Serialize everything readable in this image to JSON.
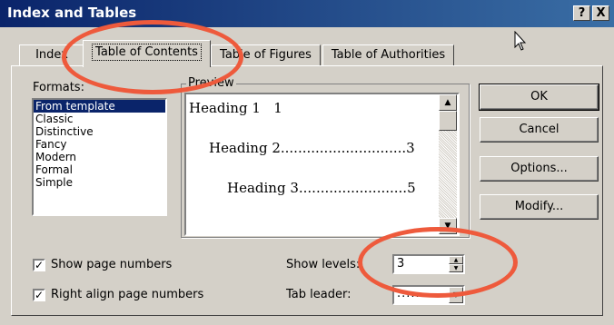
{
  "window": {
    "title": "Index and Tables",
    "help_button": "?",
    "close_button": "X"
  },
  "tabs": [
    {
      "label": "Index",
      "active": false
    },
    {
      "label": "Table of Contents",
      "active": true
    },
    {
      "label": "Table of Figures",
      "active": false
    },
    {
      "label": "Table of Authorities",
      "active": false
    }
  ],
  "formats": {
    "label": "Formats:",
    "items": [
      "From template",
      "Classic",
      "Distinctive",
      "Fancy",
      "Modern",
      "Formal",
      "Simple"
    ],
    "selected": "From template"
  },
  "preview": {
    "label": "Preview",
    "lines": [
      {
        "heading": "Heading 1",
        "leader": "   ",
        "page": "1"
      },
      {
        "heading": "Heading 2",
        "leader": ".............................",
        "page": "3"
      },
      {
        "heading": "Heading 3",
        "leader": ".........................",
        "page": "5"
      }
    ]
  },
  "buttons": {
    "ok": "OK",
    "cancel": "Cancel",
    "options": "Options...",
    "modify": "Modify..."
  },
  "options": {
    "show_page_numbers": {
      "label": "Show page numbers",
      "checked": true
    },
    "right_align": {
      "label": "Right align page numbers",
      "checked": true
    },
    "show_levels": {
      "label": "Show levels:",
      "value": "3"
    },
    "tab_leader": {
      "label": "Tab leader:",
      "value": "......."
    }
  },
  "colors": {
    "dialog_face": "#d4d0c8",
    "title_bar": "#0a246a",
    "selection": "#0a246a",
    "annotation": "#ee5a3c"
  },
  "icons": [
    "help-icon",
    "close-icon",
    "scroll-up-icon",
    "scroll-down-icon",
    "spin-up-icon",
    "spin-down-icon",
    "dropdown-arrow-icon",
    "checkmark-icon",
    "mouse-cursor-icon"
  ]
}
